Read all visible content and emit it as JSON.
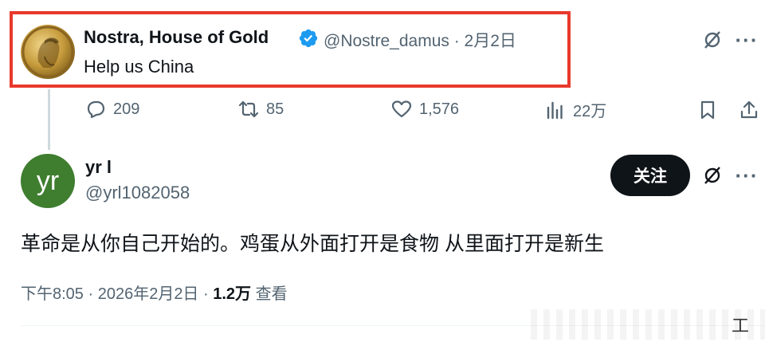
{
  "parent_tweet": {
    "author_name": "Nostra, House of Gold",
    "handle_date": "@Nostre_damus · 2月2日",
    "text": "Help us China",
    "stats": {
      "replies": "209",
      "reposts": "85",
      "likes": "1,576",
      "views": "22万"
    },
    "avatar_icon": "gold-coin-portrait-icon"
  },
  "reply_tweet": {
    "avatar_text": "yr",
    "author_name": "yr l",
    "handle": "@yrl1082058",
    "follow_label": "关注",
    "text": "革命是从你自己开始的。鸡蛋从外面打开是食物 从里面打开是新生",
    "time": "下午8:05 · 2026年2月2日 · ",
    "view_count": "1.2万",
    "view_label": " 查看"
  },
  "watermark_text": "工",
  "colors": {
    "highlight": "#e8392c",
    "verified": "#1d9bf0",
    "muted": "#536471",
    "avatar2_bg": "#3f7d2f"
  }
}
